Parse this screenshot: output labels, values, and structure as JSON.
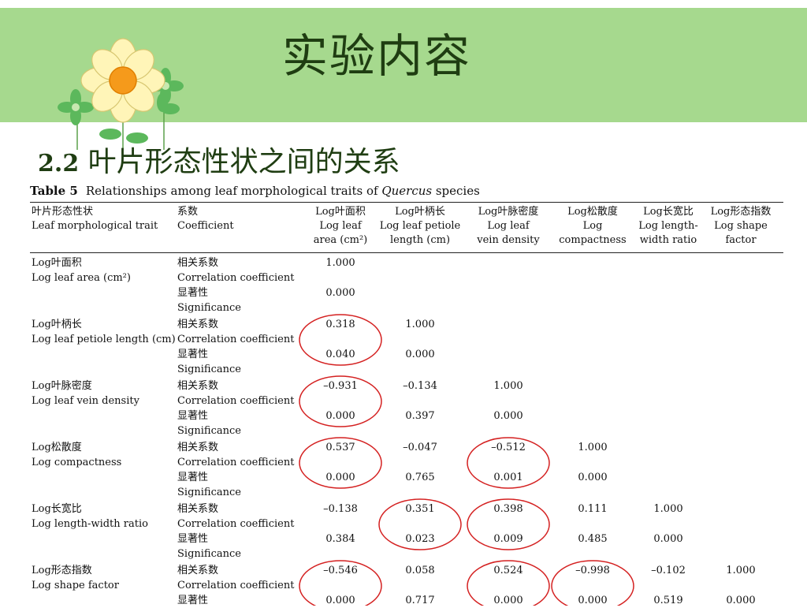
{
  "slide": {
    "title": "实验内容",
    "section_number": "2.2",
    "section_title": "叶片形态性状之间的关系"
  },
  "table": {
    "caption_label": "Table 5",
    "caption_text": "Relationships among leaf morphological traits of",
    "caption_genus": "Quercus",
    "caption_tail": "species",
    "header": {
      "trait_cn": "叶片形态性状",
      "trait_en": "Leaf morphological trait",
      "coef_cn": "系数",
      "coef_en": "Coefficient",
      "columns": [
        {
          "l1": "Log叶面积",
          "l2": "Log leaf",
          "l3": "area (cm²)"
        },
        {
          "l1": "Log叶柄长",
          "l2": "Log leaf petiole",
          "l3": "length (cm)"
        },
        {
          "l1": "Log叶脉密度",
          "l2": "Log leaf",
          "l3": "vein density"
        },
        {
          "l1": "Log松散度",
          "l2": "Log",
          "l3": "compactness"
        },
        {
          "l1": "Log长宽比",
          "l2": "Log length-",
          "l3": "width ratio"
        },
        {
          "l1": "Log形态指数",
          "l2": "Log shape",
          "l3": "factor"
        }
      ]
    },
    "labels": {
      "corr_cn": "相关系数",
      "corr_en": "Correlation coefficient",
      "sig_cn": "显著性",
      "sig_en": "Significance"
    },
    "rows": [
      {
        "name_cn": "Log叶面积",
        "name_en": "Log leaf area (cm²)",
        "corr": [
          "1.000"
        ],
        "sig": [
          "0.000"
        ]
      },
      {
        "name_cn": "Log叶柄长",
        "name_en": "Log leaf petiole length (cm)",
        "corr": [
          "0.318",
          "1.000"
        ],
        "sig": [
          "0.040",
          "0.000"
        ]
      },
      {
        "name_cn": "Log叶脉密度",
        "name_en": "Log leaf vein density",
        "corr": [
          "–0.931",
          "–0.134",
          "1.000"
        ],
        "sig": [
          "0.000",
          "0.397",
          "0.000"
        ]
      },
      {
        "name_cn": "Log松散度",
        "name_en": "Log compactness",
        "corr": [
          "0.537",
          "–0.047",
          "–0.512",
          "1.000"
        ],
        "sig": [
          "0.000",
          "0.765",
          "0.001",
          "0.000"
        ]
      },
      {
        "name_cn": "Log长宽比",
        "name_en": "Log length-width ratio",
        "corr": [
          "–0.138",
          "0.351",
          "0.398",
          "0.111",
          "1.000"
        ],
        "sig": [
          "0.384",
          "0.023",
          "0.009",
          "0.485",
          "0.000"
        ]
      },
      {
        "name_cn": "Log形态指数",
        "name_en": "Log shape factor",
        "corr": [
          "–0.546",
          "0.058",
          "0.524",
          "–0.998",
          "–0.102",
          "1.000"
        ],
        "sig": [
          "0.000",
          "0.717",
          "0.000",
          "0.000",
          "0.519",
          "0.000"
        ]
      }
    ],
    "highlighted_cells": [
      {
        "row": 1,
        "col": 0
      },
      {
        "row": 2,
        "col": 0
      },
      {
        "row": 3,
        "col": 0
      },
      {
        "row": 3,
        "col": 2
      },
      {
        "row": 4,
        "col": 1
      },
      {
        "row": 4,
        "col": 2
      },
      {
        "row": 5,
        "col": 0
      },
      {
        "row": 5,
        "col": 2
      },
      {
        "row": 5,
        "col": 3
      }
    ]
  },
  "colors": {
    "banner": "#a6d98e",
    "title_text": "#1f3d12",
    "highlight_ring": "#d42020",
    "petal": "#fff5b8",
    "flower_center": "#f59a1b",
    "leaf": "#5cb85c"
  },
  "icons": [
    "flower-decoration-icon"
  ]
}
